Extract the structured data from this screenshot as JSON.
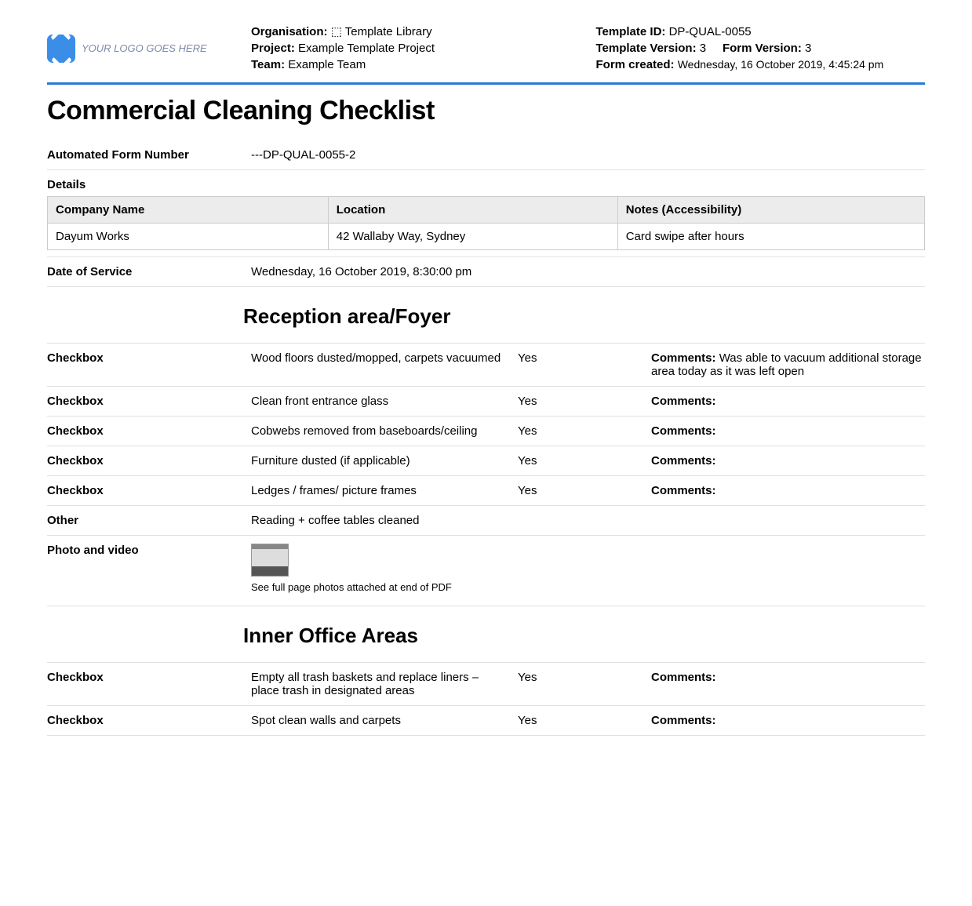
{
  "logo": {
    "placeholder": "YOUR LOGO GOES HERE"
  },
  "meta": {
    "left": {
      "organisation_label": "Organisation:",
      "organisation_value": "⬚ Template Library",
      "project_label": "Project:",
      "project_value": "Example Template Project",
      "team_label": "Team:",
      "team_value": "Example Team"
    },
    "right": {
      "template_id_label": "Template ID:",
      "template_id_value": "DP-QUAL-0055",
      "template_version_label": "Template Version:",
      "template_version_value": "3",
      "form_version_label": "Form Version:",
      "form_version_value": "3",
      "form_created_label": "Form created:",
      "form_created_value": "Wednesday, 16 October 2019, 4:45:24 pm"
    }
  },
  "title": "Commercial Cleaning Checklist",
  "auto_form": {
    "label": "Automated Form Number",
    "value": "---DP-QUAL-0055-2"
  },
  "details": {
    "heading": "Details",
    "headers": {
      "company": "Company Name",
      "location": "Location",
      "notes": "Notes (Accessibility)"
    },
    "row": {
      "company": "Dayum Works",
      "location": "42 Wallaby Way, Sydney",
      "notes": "Card swipe after hours"
    }
  },
  "date_of_service": {
    "label": "Date of Service",
    "value": "Wednesday, 16 October 2019, 8:30:00 pm"
  },
  "labels": {
    "checkbox": "Checkbox",
    "other": "Other",
    "photo_video": "Photo and video",
    "comments": "Comments:"
  },
  "sections": {
    "reception": {
      "title": "Reception area/Foyer",
      "items": [
        {
          "task": "Wood floors dusted/mopped, carpets vacuumed",
          "answer": "Yes",
          "comments": "Was able to vacuum additional storage area today as it was left open"
        },
        {
          "task": "Clean front entrance glass",
          "answer": "Yes",
          "comments": ""
        },
        {
          "task": "Cobwebs removed from baseboards/ceiling",
          "answer": "Yes",
          "comments": ""
        },
        {
          "task": "Furniture dusted (if applicable)",
          "answer": "Yes",
          "comments": ""
        },
        {
          "task": "Ledges / frames/ picture frames",
          "answer": "Yes",
          "comments": ""
        }
      ],
      "other": "Reading + coffee tables cleaned",
      "photo_caption": "See full page photos attached at end of PDF"
    },
    "inner_office": {
      "title": "Inner Office Areas",
      "items": [
        {
          "task": "Empty all trash baskets and replace liners – place trash in designated areas",
          "answer": "Yes",
          "comments": ""
        },
        {
          "task": "Spot clean walls and carpets",
          "answer": "Yes",
          "comments": ""
        }
      ]
    }
  }
}
